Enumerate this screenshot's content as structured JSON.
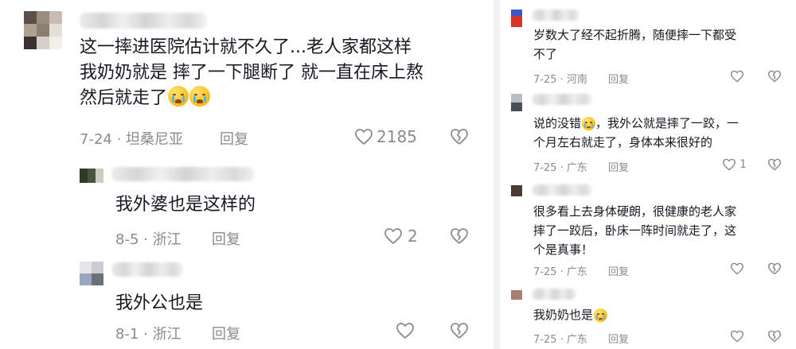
{
  "left": {
    "comments": [
      {
        "text_line1": "这一摔进医院估计就不久了...老人家都这样",
        "text_line2": "我奶奶就是 摔了一下腿断了 就一直在床上熬",
        "text_line3": "然后就走了",
        "emoji": [
          "crying-face",
          "crying-face"
        ],
        "date_location": "7-24 · 坦桑尼亚",
        "reply_label": "回复",
        "like_count": "2185"
      },
      {
        "text": "我外婆也是这样的",
        "date_location": "8-5 · 浙江",
        "reply_label": "回复",
        "like_count": "2"
      },
      {
        "text": "我外公也是",
        "date_location": "8-1 · 浙江",
        "reply_label": "回复",
        "like_count": ""
      }
    ]
  },
  "right": {
    "comments": [
      {
        "text_line1": "岁数大了经不起折腾，随便摔一下都受",
        "text_line2": "不了",
        "date_location": "7-25 · 河南",
        "reply_label": "回复",
        "like_count": ""
      },
      {
        "text_line1": "说的没错",
        "text_line1_after_emoji": "，我外公就是摔了一跤，一",
        "text_line2": "个月左右就走了，身体本来很好的",
        "emoji": [
          "crying-face"
        ],
        "date_location": "7-25 · 广东",
        "reply_label": "回复",
        "like_count": "1"
      },
      {
        "text_line1": "很多看上去身体硬朗，很健康的老人家",
        "text_line2": "摔了一跤后，卧床一阵时间就走了，这",
        "text_line3": "个是真事！",
        "date_location": "7-25 · 广东",
        "reply_label": "回复",
        "like_count": ""
      },
      {
        "text": "我奶奶也是",
        "emoji": [
          "crying-face"
        ],
        "date_location": "7-25 · 广东",
        "reply_label": "回复",
        "like_count": ""
      }
    ]
  },
  "icons": {
    "like": "heart-outline-icon",
    "dislike": "broken-heart-icon",
    "emoji": "crying-face-emoji"
  },
  "colors": {
    "text": "#161823",
    "meta": "#8a8b91",
    "background": "#ffffff"
  }
}
